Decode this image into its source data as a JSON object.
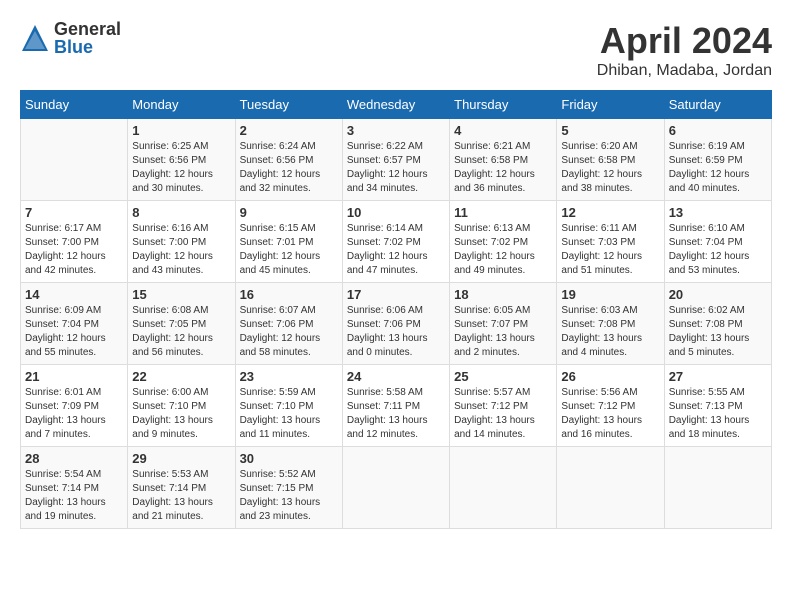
{
  "logo": {
    "general": "General",
    "blue": "Blue"
  },
  "title": "April 2024",
  "location": "Dhiban, Madaba, Jordan",
  "days_header": [
    "Sunday",
    "Monday",
    "Tuesday",
    "Wednesday",
    "Thursday",
    "Friday",
    "Saturday"
  ],
  "weeks": [
    [
      {
        "day": "",
        "info": ""
      },
      {
        "day": "1",
        "info": "Sunrise: 6:25 AM\nSunset: 6:56 PM\nDaylight: 12 hours\nand 30 minutes."
      },
      {
        "day": "2",
        "info": "Sunrise: 6:24 AM\nSunset: 6:56 PM\nDaylight: 12 hours\nand 32 minutes."
      },
      {
        "day": "3",
        "info": "Sunrise: 6:22 AM\nSunset: 6:57 PM\nDaylight: 12 hours\nand 34 minutes."
      },
      {
        "day": "4",
        "info": "Sunrise: 6:21 AM\nSunset: 6:58 PM\nDaylight: 12 hours\nand 36 minutes."
      },
      {
        "day": "5",
        "info": "Sunrise: 6:20 AM\nSunset: 6:58 PM\nDaylight: 12 hours\nand 38 minutes."
      },
      {
        "day": "6",
        "info": "Sunrise: 6:19 AM\nSunset: 6:59 PM\nDaylight: 12 hours\nand 40 minutes."
      }
    ],
    [
      {
        "day": "7",
        "info": "Sunrise: 6:17 AM\nSunset: 7:00 PM\nDaylight: 12 hours\nand 42 minutes."
      },
      {
        "day": "8",
        "info": "Sunrise: 6:16 AM\nSunset: 7:00 PM\nDaylight: 12 hours\nand 43 minutes."
      },
      {
        "day": "9",
        "info": "Sunrise: 6:15 AM\nSunset: 7:01 PM\nDaylight: 12 hours\nand 45 minutes."
      },
      {
        "day": "10",
        "info": "Sunrise: 6:14 AM\nSunset: 7:02 PM\nDaylight: 12 hours\nand 47 minutes."
      },
      {
        "day": "11",
        "info": "Sunrise: 6:13 AM\nSunset: 7:02 PM\nDaylight: 12 hours\nand 49 minutes."
      },
      {
        "day": "12",
        "info": "Sunrise: 6:11 AM\nSunset: 7:03 PM\nDaylight: 12 hours\nand 51 minutes."
      },
      {
        "day": "13",
        "info": "Sunrise: 6:10 AM\nSunset: 7:04 PM\nDaylight: 12 hours\nand 53 minutes."
      }
    ],
    [
      {
        "day": "14",
        "info": "Sunrise: 6:09 AM\nSunset: 7:04 PM\nDaylight: 12 hours\nand 55 minutes."
      },
      {
        "day": "15",
        "info": "Sunrise: 6:08 AM\nSunset: 7:05 PM\nDaylight: 12 hours\nand 56 minutes."
      },
      {
        "day": "16",
        "info": "Sunrise: 6:07 AM\nSunset: 7:06 PM\nDaylight: 12 hours\nand 58 minutes."
      },
      {
        "day": "17",
        "info": "Sunrise: 6:06 AM\nSunset: 7:06 PM\nDaylight: 13 hours\nand 0 minutes."
      },
      {
        "day": "18",
        "info": "Sunrise: 6:05 AM\nSunset: 7:07 PM\nDaylight: 13 hours\nand 2 minutes."
      },
      {
        "day": "19",
        "info": "Sunrise: 6:03 AM\nSunset: 7:08 PM\nDaylight: 13 hours\nand 4 minutes."
      },
      {
        "day": "20",
        "info": "Sunrise: 6:02 AM\nSunset: 7:08 PM\nDaylight: 13 hours\nand 5 minutes."
      }
    ],
    [
      {
        "day": "21",
        "info": "Sunrise: 6:01 AM\nSunset: 7:09 PM\nDaylight: 13 hours\nand 7 minutes."
      },
      {
        "day": "22",
        "info": "Sunrise: 6:00 AM\nSunset: 7:10 PM\nDaylight: 13 hours\nand 9 minutes."
      },
      {
        "day": "23",
        "info": "Sunrise: 5:59 AM\nSunset: 7:10 PM\nDaylight: 13 hours\nand 11 minutes."
      },
      {
        "day": "24",
        "info": "Sunrise: 5:58 AM\nSunset: 7:11 PM\nDaylight: 13 hours\nand 12 minutes."
      },
      {
        "day": "25",
        "info": "Sunrise: 5:57 AM\nSunset: 7:12 PM\nDaylight: 13 hours\nand 14 minutes."
      },
      {
        "day": "26",
        "info": "Sunrise: 5:56 AM\nSunset: 7:12 PM\nDaylight: 13 hours\nand 16 minutes."
      },
      {
        "day": "27",
        "info": "Sunrise: 5:55 AM\nSunset: 7:13 PM\nDaylight: 13 hours\nand 18 minutes."
      }
    ],
    [
      {
        "day": "28",
        "info": "Sunrise: 5:54 AM\nSunset: 7:14 PM\nDaylight: 13 hours\nand 19 minutes."
      },
      {
        "day": "29",
        "info": "Sunrise: 5:53 AM\nSunset: 7:14 PM\nDaylight: 13 hours\nand 21 minutes."
      },
      {
        "day": "30",
        "info": "Sunrise: 5:52 AM\nSunset: 7:15 PM\nDaylight: 13 hours\nand 23 minutes."
      },
      {
        "day": "",
        "info": ""
      },
      {
        "day": "",
        "info": ""
      },
      {
        "day": "",
        "info": ""
      },
      {
        "day": "",
        "info": ""
      }
    ]
  ]
}
